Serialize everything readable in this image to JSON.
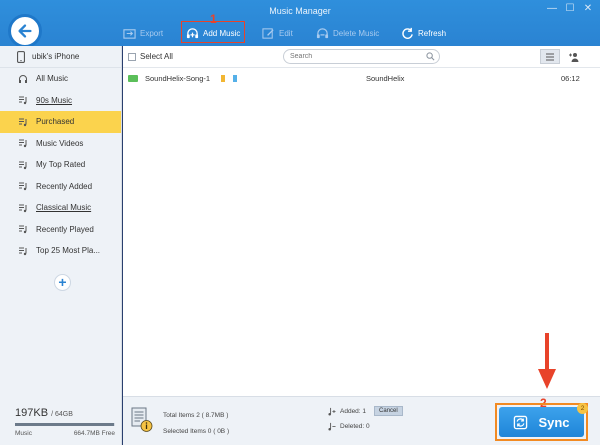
{
  "window": {
    "title": "Music Manager",
    "controls": [
      "—",
      "☐",
      "✕"
    ]
  },
  "toolbar": {
    "export_label": "Export",
    "add_music_label": "Add Music",
    "edit_label": "Edit",
    "delete_label": "Delete Music",
    "refresh_label": "Refresh",
    "step_marker": "1"
  },
  "sidebar": {
    "device_name": "ubik's iPhone",
    "items": [
      {
        "label": "All Music",
        "icon": "headphones-icon"
      },
      {
        "label": "90s Music",
        "icon": "playlist-icon"
      },
      {
        "label": "Purchased",
        "icon": "playlist-icon"
      },
      {
        "label": "Music Videos",
        "icon": "playlist-icon"
      },
      {
        "label": "My Top Rated",
        "icon": "playlist-icon"
      },
      {
        "label": "Recently Added",
        "icon": "playlist-icon"
      },
      {
        "label": "Classical Music",
        "icon": "playlist-icon"
      },
      {
        "label": "Recently Played",
        "icon": "playlist-icon"
      },
      {
        "label": "Top 25 Most Pla...",
        "icon": "playlist-icon"
      }
    ],
    "add_label": "+",
    "storage": {
      "used": "197KB",
      "total": "/ 64GB",
      "category": "Music",
      "free": "664.7MB Free",
      "fill_percent": 99
    }
  },
  "list": {
    "select_all": "Select All",
    "search_placeholder": "Search",
    "songs": [
      {
        "title": "SoundHelix-Song-1",
        "artist": "SoundHelix",
        "duration": "06:12"
      }
    ]
  },
  "footer": {
    "total_items": "Total Items 2 ( 8.7MB )",
    "selected_items": "Selected Items 0 ( 0B )",
    "added": "Added: 1",
    "cancel": "Cancel",
    "deleted": "Deleted: 0",
    "sync_label": "Sync",
    "sync_badge": "2",
    "step_marker": "2"
  },
  "colors": {
    "accent": "#2a83d2",
    "selected": "#fbd34d",
    "highlight": "#e8432a",
    "sync_outline": "#f28a22"
  }
}
